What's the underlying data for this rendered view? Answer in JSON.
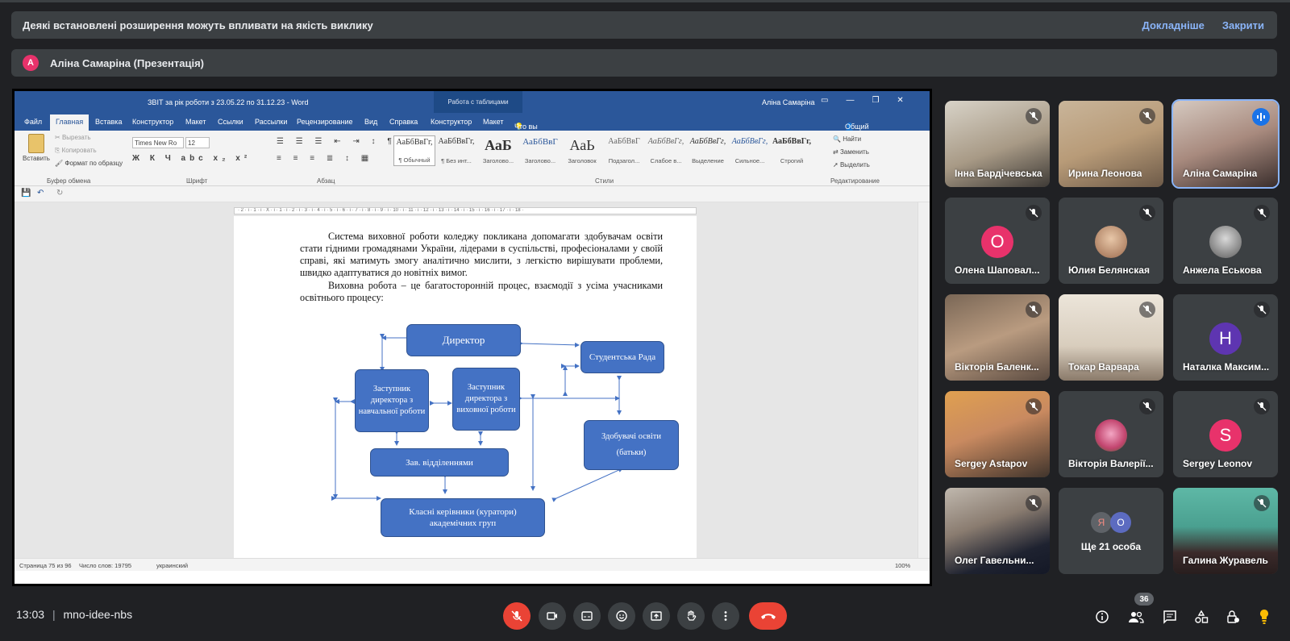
{
  "banner": {
    "message": "Деякі встановлені розширення можуть впливати на якість виклику",
    "details_link": "Докладніше",
    "close_link": "Закрити"
  },
  "presentation": {
    "avatar_letter": "A",
    "title": "Аліна Самаріна (Презентація)"
  },
  "word": {
    "doc_title": "ЗВІТ за рік роботи з 23.05.22 по 31.12.23  -  Word",
    "context_tab": "Работа с таблицами",
    "user": "Аліна Самаріна",
    "tabs": [
      "Файл",
      "Главная",
      "Вставка",
      "Конструктор",
      "Макет",
      "Ссылки",
      "Рассылки",
      "Рецензирование",
      "Вид",
      "Справка",
      "Конструктор",
      "Макет"
    ],
    "tell_me": "Что вы хотите сделать?",
    "share": "Общий доступ",
    "clipboard": {
      "paste": "Вставить",
      "cut": "Вырезать",
      "copy": "Копировать",
      "format": "Формат по образцу",
      "label": "Буфер обмена"
    },
    "font": {
      "name": "Times New Ro",
      "size": "12",
      "label": "Шрифт"
    },
    "paragraph_label": "Абзац",
    "styles_label": "Стили",
    "styles": [
      {
        "sample": "АаБбВвГг,",
        "name": "¶ Обычный"
      },
      {
        "sample": "АаБбВвГг,",
        "name": "¶ Без инт..."
      },
      {
        "sample": "АаБ",
        "name": "Заголово..."
      },
      {
        "sample": "АаБбВвГ",
        "name": "Заголово..."
      },
      {
        "sample": "АаЬ",
        "name": "Заголовок"
      },
      {
        "sample": "АаБбВвГ",
        "name": "Подзагол..."
      },
      {
        "sample": "АаБбВвГг,",
        "name": "Слабое в..."
      },
      {
        "sample": "АаБбВвГг,",
        "name": "Выделение"
      },
      {
        "sample": "АаБбВвГг,",
        "name": "Сильное..."
      },
      {
        "sample": "АаБбВвГг,",
        "name": "Строгий"
      }
    ],
    "editing": {
      "find": "Найти",
      "replace": "Заменить",
      "select": "Выделить",
      "label": "Редактирование"
    },
    "ruler_marks": "· 2 · ı · 1 · ı · X · ı · 1 · ı · 2 · ı · 3 · ı · 4 · ı · 5 · ı · 6 · ı · 7 · ı · 8 · ı · 9 · ı · 10 · ı · 11 · ı · 12 · ı · 13 · ı · 14 · ı · 15 · ı · 16 · ı · 17 · ı · 18 ·",
    "paragraph1": "Система виховної роботи коледжу покликана допомагати здобувачам освіти стати гідними громадянами України, лідерами в суспільстві, професіоналами у своїй справі, які матимуть змогу аналітично мислити, з легкістю вирішувати проблеми, швидко адаптуватися до новітніх вимог.",
    "paragraph2": "Виховна робота – це багатосторонній процес, взаємодії з усіма учасниками освітнього процесу:",
    "org_chart": {
      "director": "Директор",
      "student_council": "Студентська Рада",
      "deputy_edu": "Заступник директора з навчальної роботи",
      "deputy_up": "Заступник директора з виховної роботи",
      "students": "Здобувачі освіти",
      "parents": "(батьки)",
      "dept_heads": "Зав. відділеннями",
      "curators": "Класні керівники (куратори) академічних груп"
    },
    "status": {
      "page": "Страница 75 из 96",
      "words": "Число слов: 19795",
      "lang": "украинский",
      "zoom": "100%"
    }
  },
  "participants": [
    {
      "name": "Інна Бардічевська",
      "muted": true
    },
    {
      "name": "Ирина Леонова",
      "muted": true
    },
    {
      "name": "Аліна Самаріна",
      "speaking": true
    },
    {
      "name": "Олена Шаповал...",
      "avatar": "О",
      "color": "#e8326b",
      "muted": true
    },
    {
      "name": "Юлия Белянская",
      "muted": true
    },
    {
      "name": "Анжела Еськова",
      "muted": true
    },
    {
      "name": "Вікторія Баленк...",
      "muted": true
    },
    {
      "name": "Токар Варвара",
      "muted": true
    },
    {
      "name": "Наталка Максим...",
      "avatar": "Н",
      "color": "#5e35b1",
      "muted": true
    },
    {
      "name": "Sergey Astapov",
      "muted": true
    },
    {
      "name": "Вікторія Валерії...",
      "muted": true
    },
    {
      "name": "Sergey Leonov",
      "avatar": "S",
      "color": "#e8326b",
      "muted": true
    },
    {
      "name": "Олег Гавельни...",
      "muted": true
    },
    {
      "name": "Ще 21 особа",
      "others": [
        "Я",
        "О"
      ]
    },
    {
      "name": "Галина Журавель",
      "muted": true
    }
  ],
  "bottom": {
    "time": "13:03",
    "separator": "|",
    "meeting_code": "mno-idee-nbs",
    "participants_count": "36"
  },
  "colors": {
    "accent": "#8ab4f8",
    "red": "#ea4335",
    "word_blue": "#2b579a",
    "shape_blue": "#4472c4"
  }
}
